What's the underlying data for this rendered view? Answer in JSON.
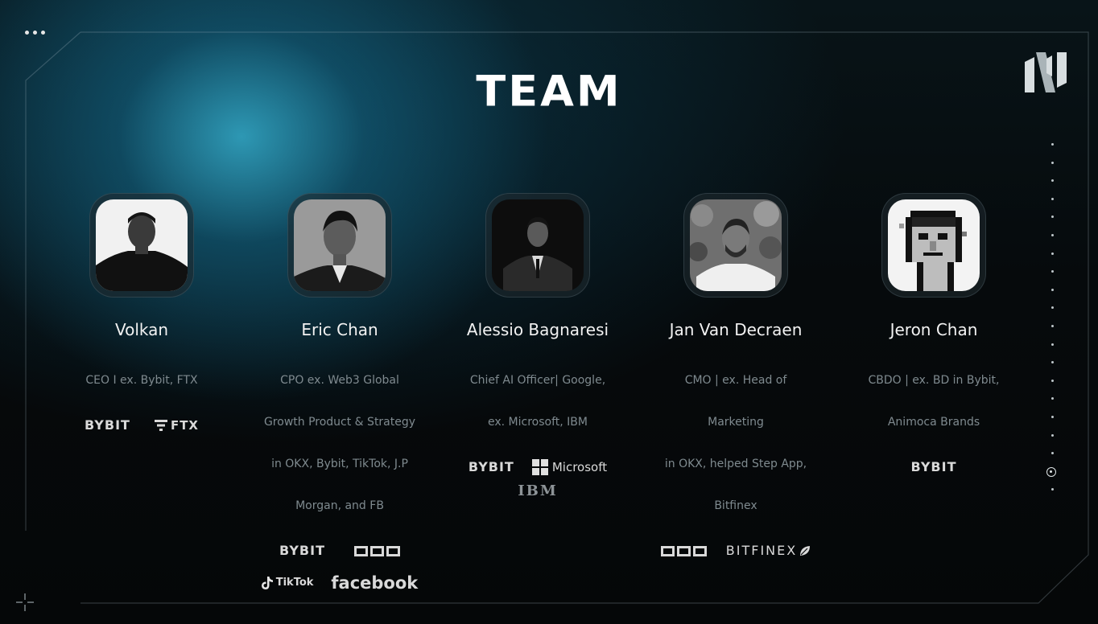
{
  "slide": {
    "title": "TEAM"
  },
  "members": [
    {
      "name": "Volkan",
      "role_lines": [
        "CEO I ex. Bybit, FTX"
      ],
      "logos": [
        "BYBIT",
        "FTX"
      ]
    },
    {
      "name": "Eric Chan",
      "role_lines": [
        "CPO ex. Web3 Global",
        "Growth Product & Strategy",
        "in OKX, Bybit, TikTok, J.P",
        "Morgan, and FB"
      ],
      "logos": [
        "BYBIT",
        "OKX",
        "TikTok",
        "facebook"
      ]
    },
    {
      "name": "Alessio Bagnaresi",
      "role_lines": [
        "Chief AI Officer| Google,",
        "ex. Microsoft, IBM"
      ],
      "logos": [
        "BYBIT",
        "Microsoft",
        "IBM"
      ]
    },
    {
      "name": "Jan Van Decraen",
      "role_lines": [
        "CMO | ex. Head of",
        "Marketing",
        "in OKX, helped Step App,",
        "Bitfinex"
      ],
      "logos": [
        "OKX",
        "BITFINEX"
      ]
    },
    {
      "name": "Jeron Chan",
      "role_lines": [
        "CBDO | ex. BD in Bybit,",
        "Animoca Brands"
      ],
      "logos": [
        "BYBIT"
      ]
    }
  ],
  "icons": {
    "menu": "more-dots-icon",
    "brand_logo": "brand-logo-icon",
    "corner": "crosshair-icon",
    "pager": "page-indicator"
  },
  "colors": {
    "background": "#050708",
    "glow": "#2fa6c4",
    "text_primary": "#f2f2f2",
    "text_secondary": "#7f8a8f"
  },
  "pager": {
    "total": 20,
    "active": 18
  }
}
